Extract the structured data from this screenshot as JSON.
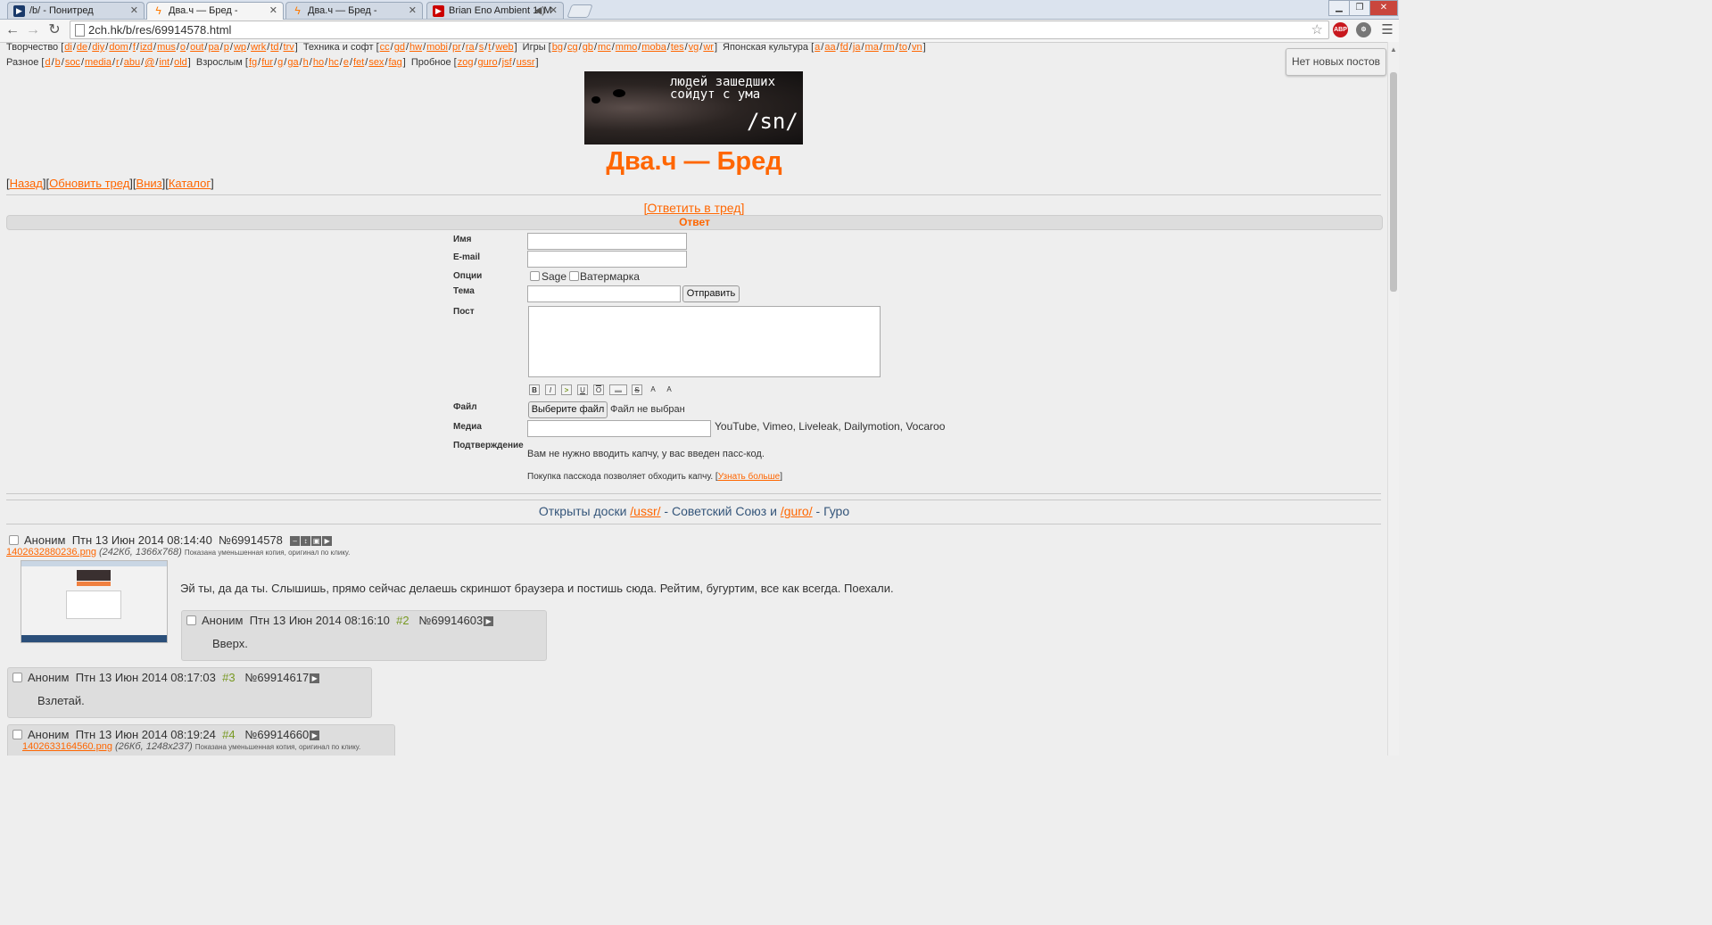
{
  "browser": {
    "tabs": [
      {
        "title": "/b/ - Понитред",
        "active": false
      },
      {
        "title": "Два.ч — Бред -",
        "active": true
      },
      {
        "title": "Два.ч — Бред -",
        "active": false
      },
      {
        "title": "Brian Eno Ambient 1: M",
        "active": false
      }
    ],
    "url": "2ch.hk/b/res/69914578.html",
    "ext_abp": "ABP"
  },
  "boards": {
    "row1": [
      {
        "group": "Творчество",
        "links": [
          "di",
          "de",
          "diy",
          "dom",
          "f",
          "izd",
          "mus",
          "o",
          "out",
          "pa",
          "p",
          "wp",
          "wrk",
          "td",
          "trv"
        ]
      },
      {
        "group": "Техника и софт",
        "links": [
          "cc",
          "gd",
          "hw",
          "mobi",
          "pr",
          "ra",
          "s",
          "t",
          "web"
        ]
      },
      {
        "group": "Игры",
        "links": [
          "bg",
          "cg",
          "gb",
          "mc",
          "mmo",
          "moba",
          "tes",
          "vg",
          "wr"
        ]
      },
      {
        "group": "Японская культура",
        "links": [
          "a",
          "aa",
          "fd",
          "ja",
          "ma",
          "rm",
          "to",
          "vn"
        ]
      }
    ],
    "row2": [
      {
        "group": "Разное",
        "links": [
          "d",
          "b",
          "soc",
          "media",
          "r",
          "abu",
          "@",
          "int",
          "old"
        ]
      },
      {
        "group": "Взрослым",
        "links": [
          "fg",
          "fur",
          "g",
          "ga",
          "h",
          "ho",
          "hc",
          "e",
          "fet",
          "sex",
          "fag"
        ]
      },
      {
        "group": "Пробное",
        "links": [
          "zog",
          "guro",
          "jsf",
          "ussr"
        ]
      }
    ]
  },
  "new_posts_button": "Нет новых постов",
  "banner": {
    "line1": "людей зашедших",
    "line2": "сойдут с ума",
    "board": "/sn/"
  },
  "site_title": "Два.ч — Бред",
  "nav": {
    "back": "Назад",
    "refresh": "Обновить тред",
    "down": "Вниз",
    "catalog": "Каталог"
  },
  "reply_link": "[Ответить в тред]",
  "form": {
    "header": "Ответ",
    "name_label": "Имя",
    "email_label": "E-mail",
    "options_label": "Опции",
    "sage_label": "Sage",
    "watermark_label": "Ватермарка",
    "subject_label": "Тема",
    "submit": "Отправить",
    "post_label": "Пост",
    "format_buttons": [
      "B",
      "I",
      ">",
      "U",
      "O",
      "▬",
      "S",
      "A",
      "A"
    ],
    "file_label": "Файл",
    "file_button": "Выберите файл",
    "file_status": "Файл не выбран",
    "media_label": "Медиа",
    "media_hint": "YouTube, Vimeo, Liveleak, Dailymotion, Vocaroo",
    "confirm_label": "Подтверждение",
    "captcha_note": "Вам не нужно вводить капчу, у вас введен пасс-код.",
    "passcode_text": "Покупка пасскода позволяет обходить капчу.",
    "learn_more": "Узнать больше"
  },
  "announcement": {
    "pre": "Открыты доски",
    "b1": "/ussr/",
    "mid": "- Советский Союз и",
    "b2": "/guro/",
    "post": "- Гуро"
  },
  "posts": [
    {
      "name": "Аноним",
      "date": "Птн 13 Июн 2014 08:14:40",
      "id": "№69914578",
      "file": "1402632880236.png",
      "fileinfo": "(242Кб, 1366x768)",
      "note": "Показана уменьшенная копия, оригинал по клику.",
      "text": "Эй ты, да да ты. Слышишь, прямо сейчас делаешь скриншот браузера и постишь сюда. Рейтим, бугуртим, все как всегда. Поехали."
    },
    {
      "name": "Аноним",
      "date": "Птн 13 Июн 2014 08:16:10",
      "n": "#2",
      "id": "№69914603",
      "text": "Вверх."
    },
    {
      "name": "Аноним",
      "date": "Птн 13 Июн 2014 08:17:03",
      "n": "#3",
      "id": "№69914617",
      "text": "Взлетай."
    },
    {
      "name": "Аноним",
      "date": "Птн 13 Июн 2014 08:19:24",
      "n": "#4",
      "id": "№69914660",
      "file": "1402633164560.png",
      "fileinfo": "(26Кб, 1248x237)",
      "note": "Показана уменьшенная копия, оригинал по клику."
    }
  ]
}
